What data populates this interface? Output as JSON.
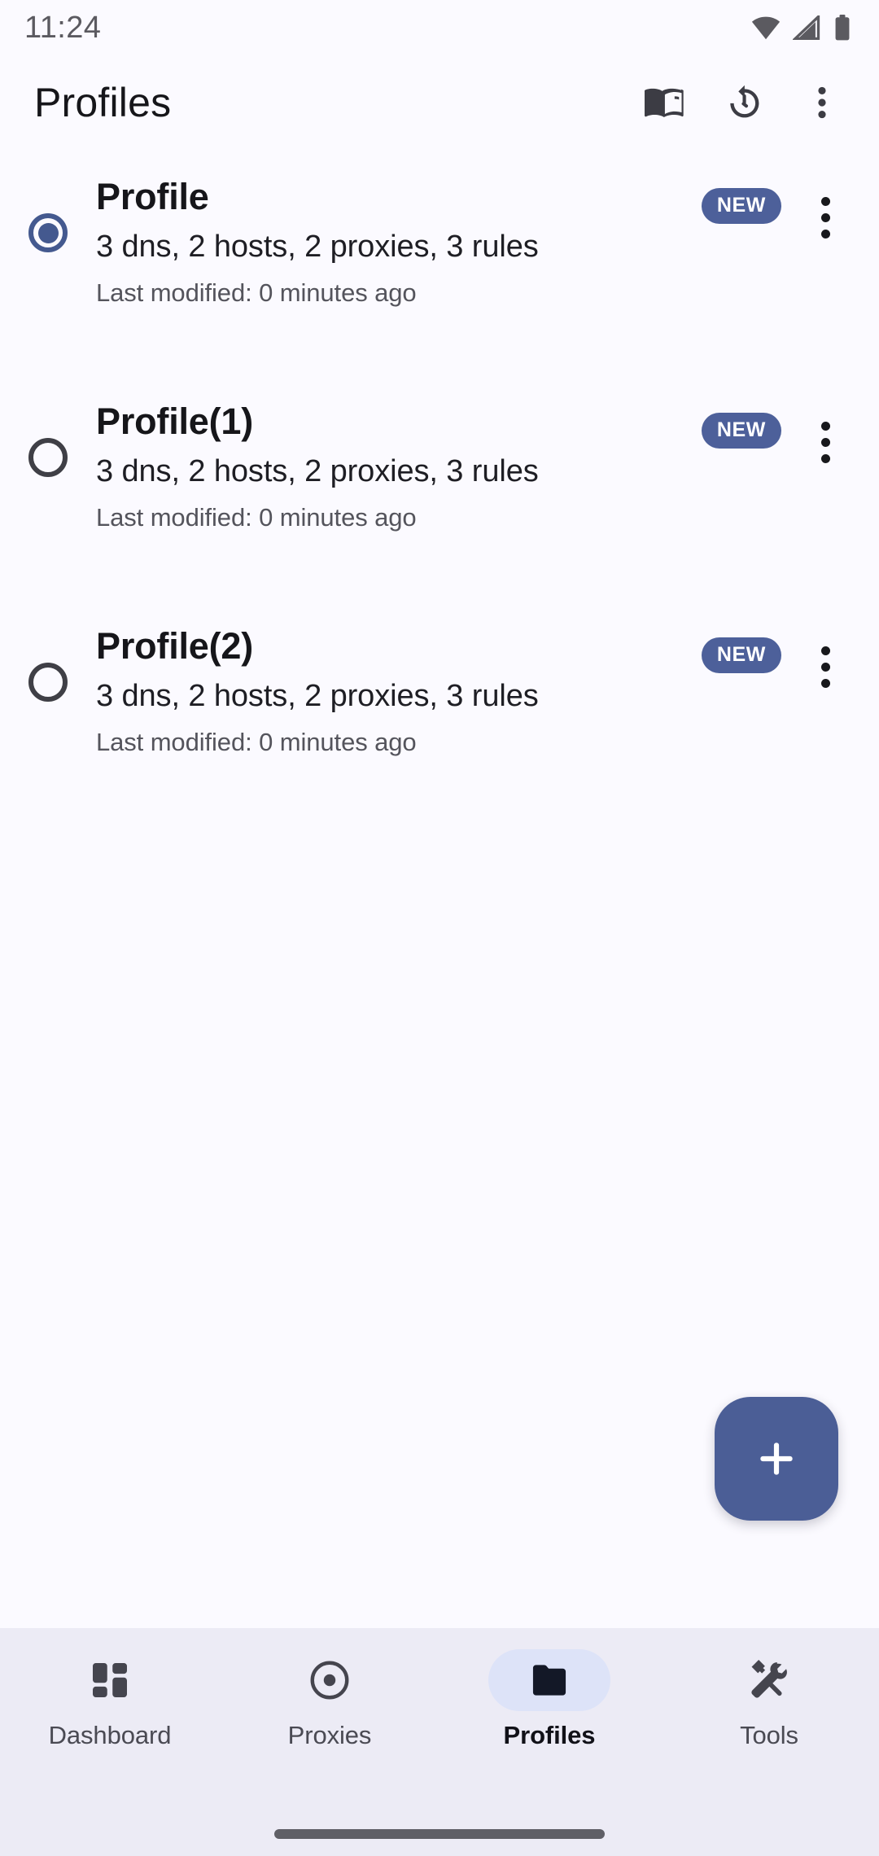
{
  "status_bar": {
    "time": "11:24",
    "icons": [
      "wifi-icon",
      "cellular-signal-icon",
      "battery-icon"
    ]
  },
  "app_bar": {
    "title": "Profiles",
    "actions": [
      {
        "name": "menu-book-icon",
        "label": "Library"
      },
      {
        "name": "history-icon",
        "label": "History"
      },
      {
        "name": "overflow-menu-icon",
        "label": "More options"
      }
    ]
  },
  "profiles": [
    {
      "title": "Profile",
      "subtitle": "3 dns, 2 hosts, 2 proxies, 3 rules",
      "meta": "Last modified: 0 minutes ago",
      "badge": "NEW",
      "selected": true
    },
    {
      "title": "Profile(1)",
      "subtitle": "3 dns, 2 hosts, 2 proxies, 3 rules",
      "meta": "Last modified: 0 minutes ago",
      "badge": "NEW",
      "selected": false
    },
    {
      "title": "Profile(2)",
      "subtitle": "3 dns, 2 hosts, 2 proxies, 3 rules",
      "meta": "Last modified: 0 minutes ago",
      "badge": "NEW",
      "selected": false
    }
  ],
  "fab": {
    "icon": "plus-icon",
    "label": "Add profile"
  },
  "bottom_nav": {
    "items": [
      {
        "label": "Dashboard",
        "icon": "dashboard-icon",
        "active": false
      },
      {
        "label": "Proxies",
        "icon": "target-icon",
        "active": false
      },
      {
        "label": "Profiles",
        "icon": "folder-icon",
        "active": true
      },
      {
        "label": "Tools",
        "icon": "handyman-icon",
        "active": false
      }
    ]
  },
  "colors": {
    "accent": "#4b5e96",
    "badge": "#4d609a",
    "nav_bar_bg": "#ecebf5",
    "nav_active_pill": "#dde3f8",
    "page_bg": "#fbfaff",
    "text_primary": "#16161a",
    "text_secondary": "#54545c"
  }
}
